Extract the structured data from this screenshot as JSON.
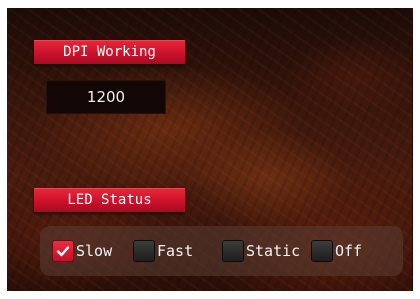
{
  "dpi": {
    "label": "DPI Working",
    "value": "1200"
  },
  "led": {
    "label": "LED Status",
    "options": [
      {
        "label": "Slow",
        "checked": true
      },
      {
        "label": "Fast",
        "checked": false
      },
      {
        "label": "Static",
        "checked": false
      },
      {
        "label": "Off",
        "checked": false
      }
    ]
  },
  "colors": {
    "accent": "#c8102a",
    "checkbox_unchecked": "#2a2a2a",
    "panel": "#5a3e34"
  },
  "icons": {
    "checked": "checkmark-icon"
  }
}
